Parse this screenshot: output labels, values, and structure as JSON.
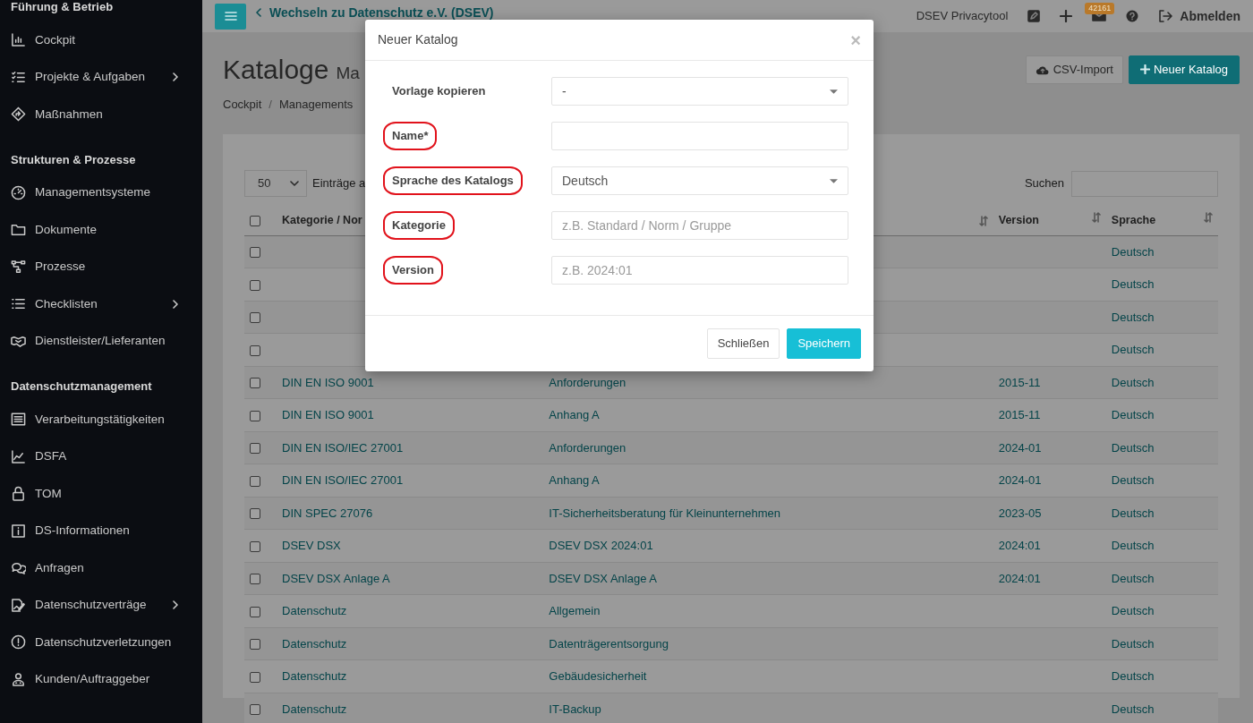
{
  "sidebar": {
    "sections": [
      {
        "title": "Führung & Betrieb",
        "items": [
          {
            "label": "Cockpit",
            "has_submenu": false
          },
          {
            "label": "Projekte & Aufgaben",
            "has_submenu": true
          },
          {
            "label": "Maßnahmen",
            "has_submenu": false
          }
        ]
      },
      {
        "title": "Strukturen & Prozesse",
        "items": [
          {
            "label": "Managementsysteme",
            "has_submenu": false
          },
          {
            "label": "Dokumente",
            "has_submenu": false
          },
          {
            "label": "Prozesse",
            "has_submenu": false
          },
          {
            "label": "Checklisten",
            "has_submenu": true
          },
          {
            "label": "Dienstleister/Lieferanten",
            "has_submenu": false
          }
        ]
      },
      {
        "title": "Datenschutzmanagement",
        "items": [
          {
            "label": "Verarbeitungstätigkeiten",
            "has_submenu": false
          },
          {
            "label": "DSFA",
            "has_submenu": false
          },
          {
            "label": "TOM",
            "has_submenu": false
          },
          {
            "label": "DS-Informationen",
            "has_submenu": false
          },
          {
            "label": "Anfragen",
            "has_submenu": false
          },
          {
            "label": "Datenschutzverträge",
            "has_submenu": true
          },
          {
            "label": "Datenschutzverletzungen",
            "has_submenu": false
          },
          {
            "label": "Kunden/Auftraggeber",
            "has_submenu": false
          }
        ]
      }
    ]
  },
  "topbar": {
    "back_link": "Wechseln zu Datenschutz e.V. (DSEV)",
    "app_name": "DSEV Privacytool",
    "mail_badge": "42161",
    "logout": "Abmelden"
  },
  "page": {
    "title": "Kataloge",
    "subtitle": "Ma",
    "breadcrumb": [
      "Cockpit",
      "Managements"
    ],
    "breadcrumb_separator": "/",
    "buttons": [
      {
        "label": "CSV-Import",
        "kind": "import"
      },
      {
        "label": "Neuer Katalog",
        "kind": "add"
      }
    ]
  },
  "table": {
    "page_size": "50",
    "page_size_text": "Einträge a",
    "search_label": "Suchen",
    "select_all_checked": false,
    "columns": [
      {
        "label": "Kategorie / Nor",
        "sortable": false
      },
      {
        "sortable": true
      },
      {
        "label": "Version",
        "sortable": true
      },
      {
        "label": "Sprache",
        "sortable": true
      }
    ],
    "rows": [
      {
        "checked": false,
        "language": "Deutsch"
      },
      {
        "checked": false,
        "language": "Deutsch"
      },
      {
        "checked": false,
        "language": "Deutsch"
      },
      {
        "checked": false,
        "language": "Deutsch"
      },
      {
        "checked": false,
        "category": "DIN EN ISO 9001",
        "name": "Anforderungen",
        "version": "2015-11",
        "language": "Deutsch"
      },
      {
        "checked": false,
        "category": "DIN EN ISO 9001",
        "name": "Anhang A",
        "version": "2015-11",
        "language": "Deutsch"
      },
      {
        "checked": false,
        "category": "DIN EN ISO/IEC 27001",
        "name": "Anforderungen",
        "version": "2024-01",
        "language": "Deutsch"
      },
      {
        "checked": false,
        "category": "DIN EN ISO/IEC 27001",
        "name": "Anhang A",
        "version": "2024-01",
        "language": "Deutsch"
      },
      {
        "checked": false,
        "category": "DIN SPEC 27076",
        "name": "IT-Sicherheitsberatung für Kleinunternehmen",
        "version": "2023-05",
        "language": "Deutsch"
      },
      {
        "checked": false,
        "category": "DSEV DSX",
        "name": "DSEV DSX 2024:01",
        "version": "2024:01",
        "language": "Deutsch"
      },
      {
        "checked": false,
        "category": "DSEV DSX Anlage A",
        "name": "DSEV DSX Anlage A",
        "version": "2024:01",
        "language": "Deutsch"
      },
      {
        "checked": false,
        "category": "Datenschutz",
        "name": "Allgemein",
        "language": "Deutsch"
      },
      {
        "checked": false,
        "category": "Datenschutz",
        "name": "Datenträgerentsorgung",
        "language": "Deutsch"
      },
      {
        "checked": false,
        "category": "Datenschutz",
        "name": "Gebäudesicherheit",
        "language": "Deutsch"
      },
      {
        "checked": false,
        "category": "Datenschutz",
        "name": "IT-Backup",
        "language": "Deutsch"
      }
    ]
  },
  "modal": {
    "title": "Neuer Katalog",
    "close": "×",
    "fields": [
      {
        "label": "Vorlage kopieren",
        "kind": "select",
        "value": "-",
        "highlighted": false
      },
      {
        "label": "Name*",
        "kind": "input",
        "highlighted": true
      },
      {
        "label": "Sprache des Katalogs",
        "kind": "select",
        "value": "Deutsch",
        "highlighted": true
      },
      {
        "label": "Kategorie",
        "kind": "input",
        "placeholder": "z.B. Standard / Norm / Gruppe",
        "highlighted": true
      },
      {
        "label": "Version",
        "kind": "input",
        "placeholder": "z.B. 2024:01",
        "highlighted": true
      }
    ],
    "buttons": [
      {
        "label": "Schließen",
        "kind": "secondary"
      },
      {
        "label": "Speichern",
        "kind": "primary"
      }
    ]
  }
}
